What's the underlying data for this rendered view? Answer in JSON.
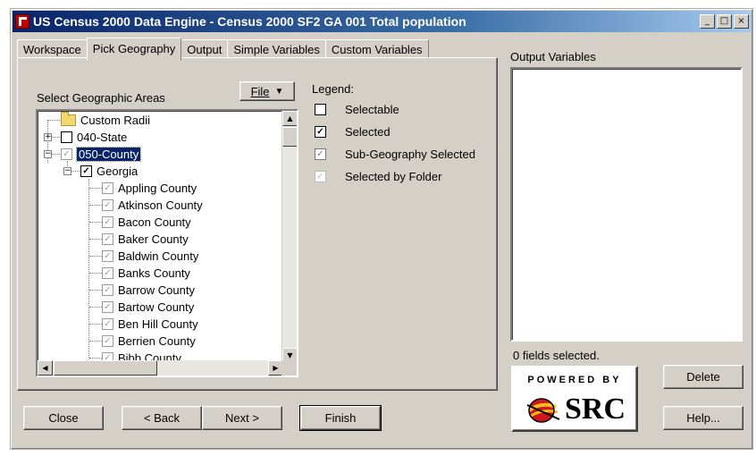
{
  "window": {
    "title": "US Census 2000 Data Engine - Census 2000 SF2 GA 001 Total population",
    "controls": {
      "minimize": "_",
      "maximize": "□",
      "close": "×"
    }
  },
  "tabs": [
    {
      "label": "Workspace",
      "active": false
    },
    {
      "label": "Pick Geography",
      "active": true
    },
    {
      "label": "Output",
      "active": false
    },
    {
      "label": "Simple Variables",
      "active": false
    },
    {
      "label": "Custom Variables",
      "active": false
    }
  ],
  "geography": {
    "label": "Select Geographic Areas",
    "file_button": "File",
    "tree": [
      {
        "label": "Custom Radii",
        "kind": "folder",
        "level": 1
      },
      {
        "label": "040-State",
        "kind": "node",
        "level": 1,
        "checked": false,
        "expander": "+"
      },
      {
        "label": "050-County",
        "kind": "node",
        "level": 1,
        "checked": "grey",
        "expander": "−",
        "highlighted": true
      },
      {
        "label": "Georgia",
        "kind": "node",
        "level": 2,
        "checked": true,
        "expander": "−"
      },
      {
        "label": "Appling County",
        "kind": "leaf",
        "level": 3,
        "checked": "grey"
      },
      {
        "label": "Atkinson County",
        "kind": "leaf",
        "level": 3,
        "checked": "grey"
      },
      {
        "label": "Bacon County",
        "kind": "leaf",
        "level": 3,
        "checked": "grey"
      },
      {
        "label": "Baker County",
        "kind": "leaf",
        "level": 3,
        "checked": "grey"
      },
      {
        "label": "Baldwin County",
        "kind": "leaf",
        "level": 3,
        "checked": "grey"
      },
      {
        "label": "Banks County",
        "kind": "leaf",
        "level": 3,
        "checked": "grey"
      },
      {
        "label": "Barrow County",
        "kind": "leaf",
        "level": 3,
        "checked": "grey"
      },
      {
        "label": "Bartow County",
        "kind": "leaf",
        "level": 3,
        "checked": "grey"
      },
      {
        "label": "Ben Hill County",
        "kind": "leaf",
        "level": 3,
        "checked": "grey"
      },
      {
        "label": "Berrien County",
        "kind": "leaf",
        "level": 3,
        "checked": "grey"
      },
      {
        "label": "Bibb County",
        "kind": "leaf",
        "level": 3,
        "checked": "grey"
      }
    ]
  },
  "legend": {
    "title": "Legend:",
    "items": [
      {
        "label": "Selectable",
        "state": "empty"
      },
      {
        "label": "Selected",
        "state": "checked"
      },
      {
        "label": "Sub-Geography Selected",
        "state": "grey"
      },
      {
        "label": "Selected by Folder",
        "state": "light"
      }
    ]
  },
  "output": {
    "label": "Output Variables",
    "status": "0 fields selected."
  },
  "logo": {
    "top": "POWERED BY",
    "brand": "SRC"
  },
  "buttons": {
    "close": "Close",
    "back": "< Back",
    "next": "Next >",
    "finish": "Finish",
    "delete": "Delete",
    "help": "Help..."
  }
}
